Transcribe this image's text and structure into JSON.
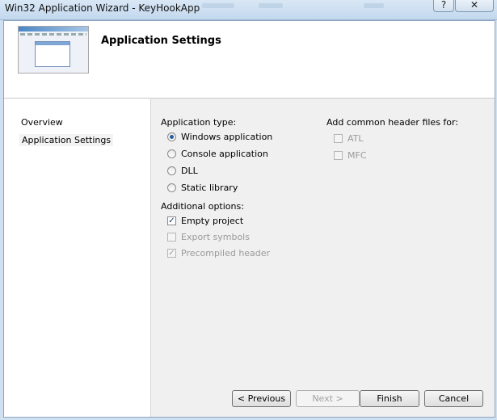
{
  "window": {
    "title": "Win32 Application Wizard - KeyHookApp",
    "help_glyph": "?",
    "close_glyph": "✕"
  },
  "header": {
    "heading": "Application Settings",
    "thumbnail_icon": "app-window-thumbnail"
  },
  "sidebar": {
    "items": [
      {
        "label": "Overview",
        "active": false
      },
      {
        "label": "Application Settings",
        "active": true
      }
    ]
  },
  "application_type": {
    "label": "Application type:",
    "options": [
      {
        "label": "Windows application",
        "selected": true
      },
      {
        "label": "Console application",
        "selected": false
      },
      {
        "label": "DLL",
        "selected": false
      },
      {
        "label": "Static library",
        "selected": false
      }
    ]
  },
  "additional_options": {
    "label": "Additional options:",
    "options": [
      {
        "label": "Empty project",
        "checked": true,
        "enabled": true
      },
      {
        "label": "Export symbols",
        "checked": false,
        "enabled": false
      },
      {
        "label": "Precompiled header",
        "checked": true,
        "enabled": false
      }
    ]
  },
  "header_files": {
    "label": "Add common header files for:",
    "options": [
      {
        "label": "ATL",
        "checked": false,
        "enabled": false
      },
      {
        "label": "MFC",
        "checked": false,
        "enabled": false
      }
    ]
  },
  "buttons": {
    "previous": "< Previous",
    "next": "Next >",
    "finish": "Finish",
    "cancel": "Cancel"
  },
  "colors": {
    "titlebar": "#c3d8ee",
    "content_bg": "#f0f0f0",
    "radio_dot": "#2a5aa0"
  }
}
